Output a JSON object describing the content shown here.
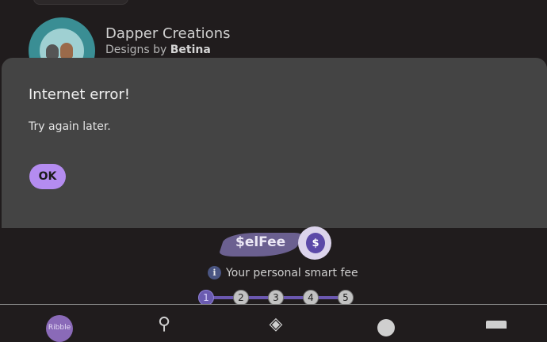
{
  "shop": {
    "name": "Dapper Creations",
    "designs_by_prefix": "Designs by",
    "designer": "Betina"
  },
  "dialog": {
    "title": "Internet error!",
    "message": "Try again later.",
    "ok_label": "OK"
  },
  "selfee": {
    "logo_text": "$elFee",
    "coin_symbol": "$",
    "tagline": "Your personal smart fee",
    "info_symbol": "i"
  },
  "steps": {
    "items": [
      "1",
      "2",
      "3",
      "4",
      "5"
    ],
    "active": 1
  },
  "bottom_nav": {
    "profile_label": "Ribble",
    "items": [
      "profile-icon",
      "search-icon",
      "tag-icon",
      "menu-icon",
      "store-icon"
    ]
  },
  "colors": {
    "background": "#201c1d",
    "dialog": "#444444",
    "accent": "#b48cf0",
    "step_active": "#6a5bb0"
  }
}
